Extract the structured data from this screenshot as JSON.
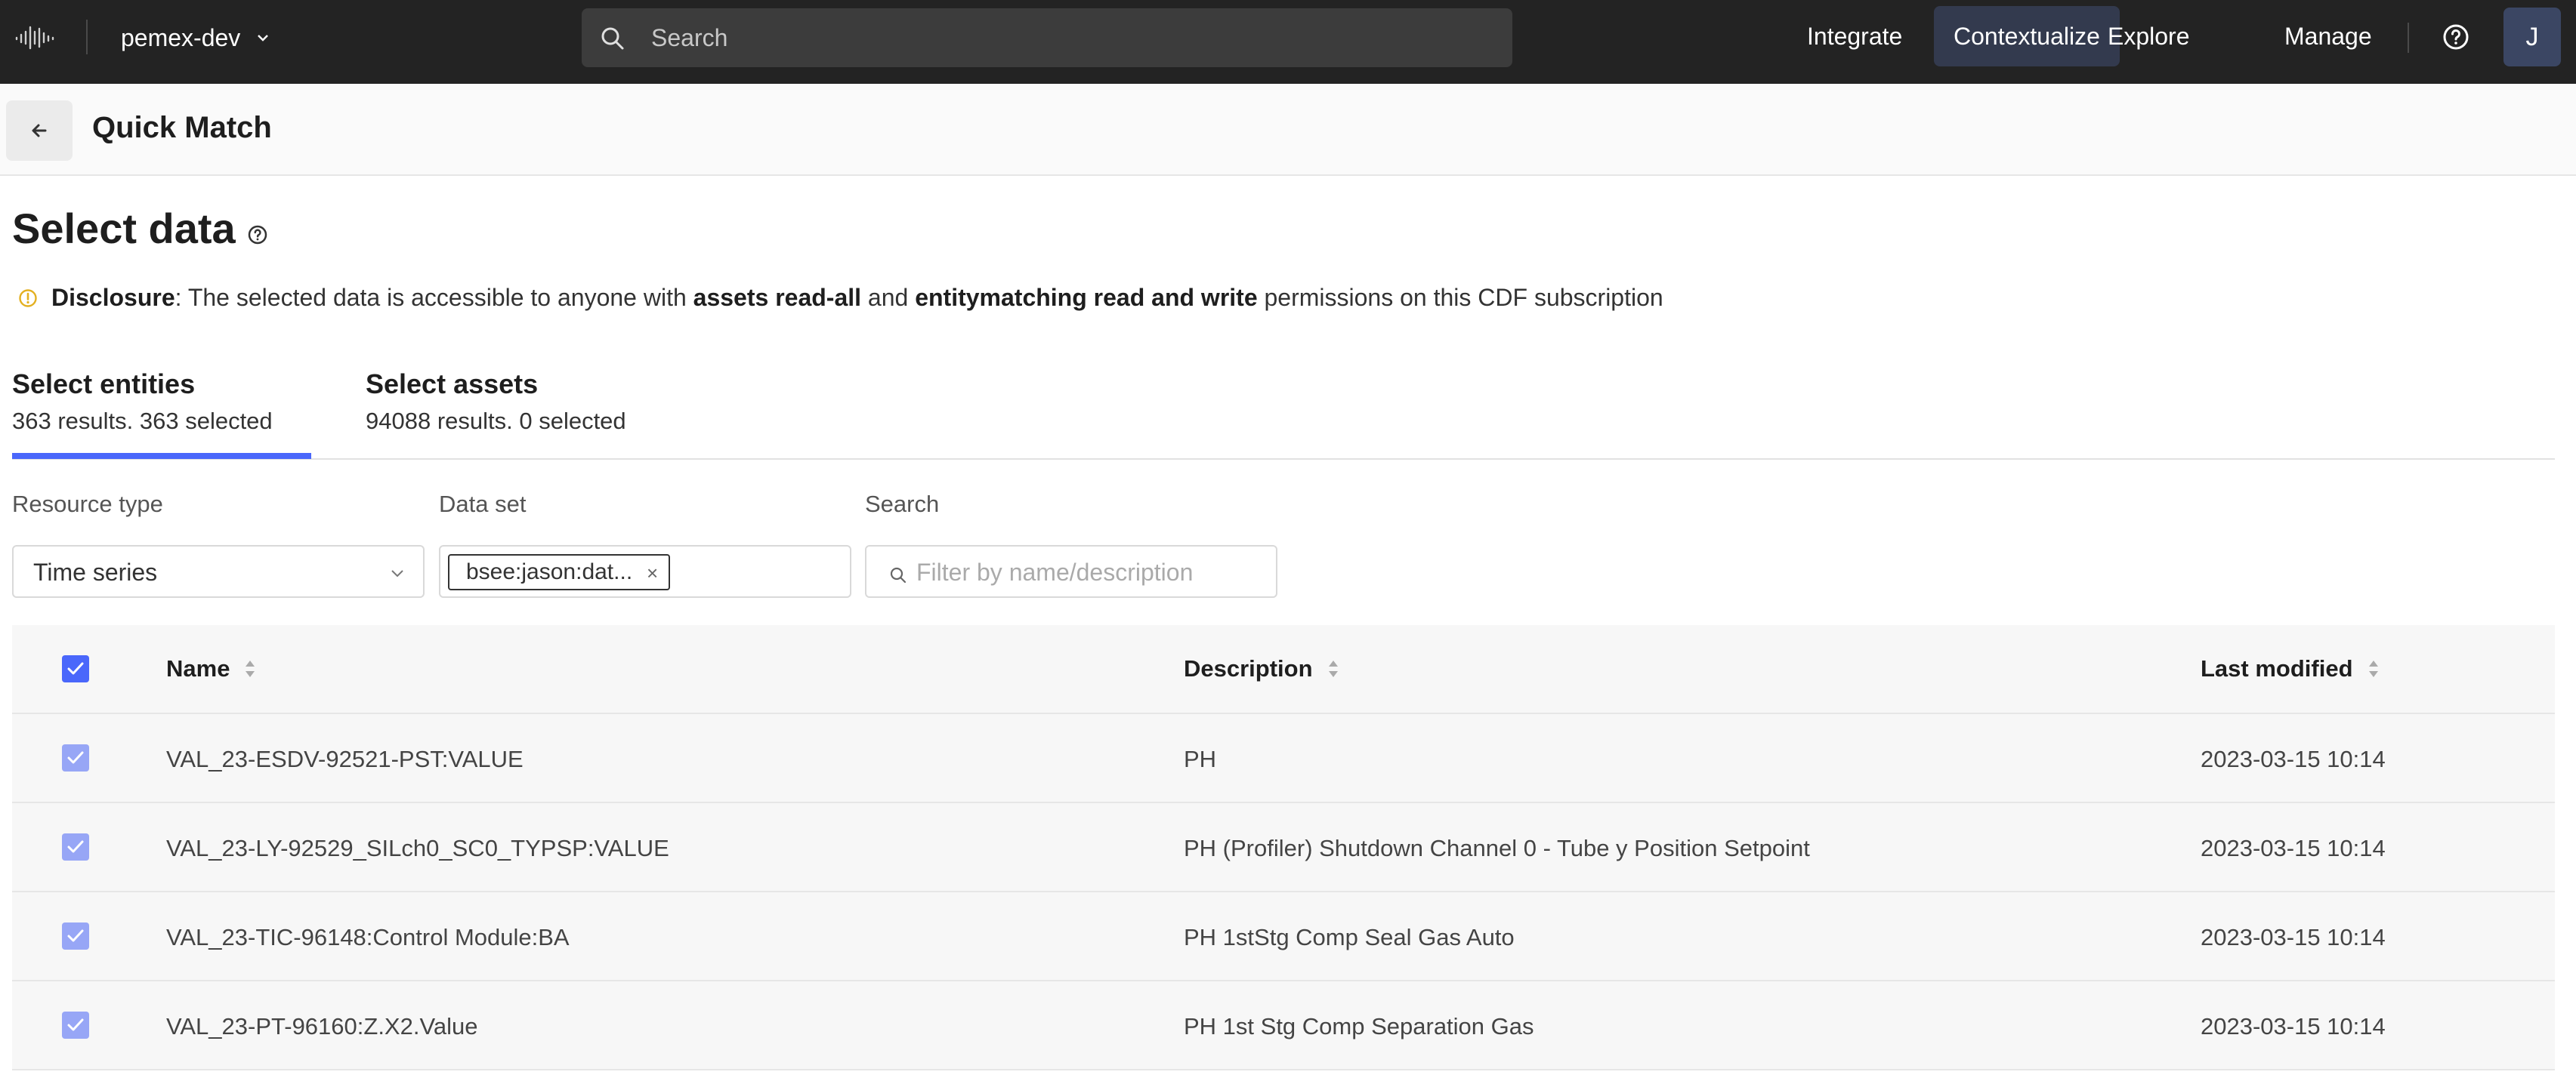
{
  "topbar": {
    "project": "pemex-dev",
    "search_placeholder": "Search",
    "nav": [
      "Integrate",
      "Contextualize",
      "Explore",
      "Manage"
    ],
    "active_nav": "Contextualize",
    "avatar_initial": "J"
  },
  "subheader": {
    "title": "Quick Match"
  },
  "section": {
    "title": "Select data",
    "disclosure": {
      "label": "Disclosure",
      "text1": ": The selected data is accessible to anyone with ",
      "bold1": "assets read-all",
      "text2": " and ",
      "bold2": "entitymatching read and write",
      "text3": " permissions on this CDF subscription"
    }
  },
  "tabs": [
    {
      "title": "Select entities",
      "subtitle": "363 results. 363 selected",
      "active": true
    },
    {
      "title": "Select assets",
      "subtitle": "94088 results. 0 selected",
      "active": false
    }
  ],
  "filters": {
    "resource_type_label": "Resource type",
    "resource_type_value": "Time series",
    "data_set_label": "Data set",
    "data_set_chip": "bsee:jason:dat...",
    "search_label": "Search",
    "search_placeholder": "Filter by name/description"
  },
  "table": {
    "columns": [
      "Name",
      "Description",
      "Last modified"
    ],
    "rows": [
      {
        "name": "VAL_23-ESDV-92521-PST:VALUE",
        "description": "PH",
        "last_modified": "2023-03-15 10:14"
      },
      {
        "name": "VAL_23-LY-92529_SILch0_SC0_TYPSP:VALUE",
        "description": "PH (Profiler) Shutdown Channel 0 - Tube y Position Setpoint",
        "last_modified": "2023-03-15 10:14"
      },
      {
        "name": "VAL_23-TIC-96148:Control Module:BA",
        "description": "PH 1stStg Comp Seal Gas Auto",
        "last_modified": "2023-03-15 10:14"
      },
      {
        "name": "VAL_23-PT-96160:Z.X2.Value",
        "description": "PH 1st Stg Comp Separation Gas",
        "last_modified": "2023-03-15 10:14"
      }
    ]
  },
  "colors": {
    "accent": "#4a67fb",
    "topbar": "#232323",
    "warning": "#e3b021"
  }
}
